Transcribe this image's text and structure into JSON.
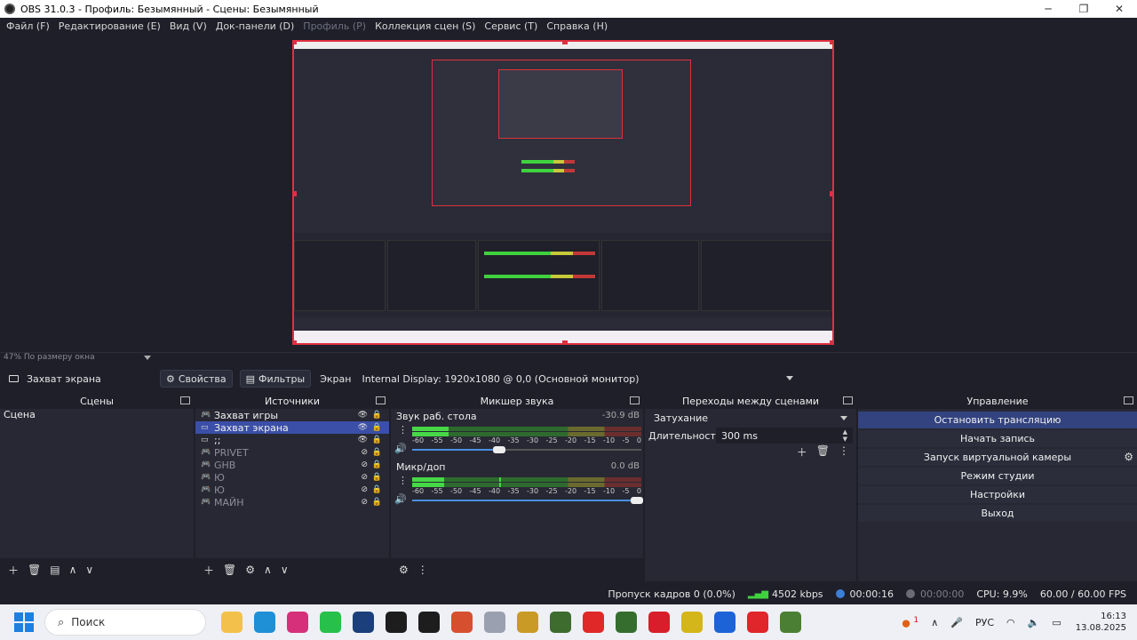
{
  "window": {
    "title": "OBS 31.0.3 - Профиль: Безымянный - Сцены: Безымянный",
    "controls": [
      "─",
      "❐",
      "✕"
    ]
  },
  "menu": [
    {
      "label": "Файл (F)",
      "enabled": true
    },
    {
      "label": "Редактирование (E)",
      "enabled": true
    },
    {
      "label": "Вид (V)",
      "enabled": true
    },
    {
      "label": "Док-панели (D)",
      "enabled": true
    },
    {
      "label": "Профиль (P)",
      "enabled": false
    },
    {
      "label": "Коллекция сцен (S)",
      "enabled": true
    },
    {
      "label": "Сервис (T)",
      "enabled": true
    },
    {
      "label": "Справка (H)",
      "enabled": true
    }
  ],
  "preview": {
    "zoom_label": "47% По размеру окна"
  },
  "source_toolbar": {
    "source_name": "Захват экрана",
    "properties": "Свойства",
    "filters": "Фильтры",
    "display_label": "Экран",
    "display_value": "Internal Display: 1920x1080 @ 0,0 (Основной монитор)"
  },
  "scenes": {
    "title": "Сцены",
    "items": [
      "Сцена"
    ]
  },
  "sources": {
    "title": "Источники",
    "items": [
      {
        "name": "Захват игры",
        "icon": "gamepad-icon",
        "visible": true,
        "selected": false
      },
      {
        "name": "Захват экрана",
        "icon": "monitor-icon",
        "visible": true,
        "selected": true
      },
      {
        "name": ";;",
        "icon": "monitor-icon",
        "visible": true,
        "selected": false
      },
      {
        "name": "PRIVET",
        "icon": "gamepad-icon",
        "visible": false,
        "selected": false
      },
      {
        "name": "GHB",
        "icon": "gamepad-icon",
        "visible": false,
        "selected": false
      },
      {
        "name": "Ю",
        "icon": "gamepad-icon",
        "visible": false,
        "selected": false
      },
      {
        "name": "Ю",
        "icon": "gamepad-icon",
        "visible": false,
        "selected": false
      },
      {
        "name": "МАЙН",
        "icon": "gamepad-icon",
        "visible": false,
        "selected": false
      }
    ]
  },
  "mixer": {
    "title": "Микшер звука",
    "ticks": [
      "-60",
      "-55",
      "-50",
      "-45",
      "-40",
      "-35",
      "-30",
      "-25",
      "-20",
      "-15",
      "-10",
      "-5",
      "0"
    ],
    "channels": [
      {
        "name": "Звук раб. стола",
        "db": "-30.9 dB",
        "level_pct": 16,
        "peak_pct": 15,
        "volume_pct": 40
      },
      {
        "name": "Микр/доп",
        "db": "0.0 dB",
        "level_pct": 14,
        "peak_pct": 38,
        "volume_pct": 100
      }
    ]
  },
  "transitions": {
    "title": "Переходы между сценами",
    "selected": "Затухание",
    "duration_label": "Длительность",
    "duration_value": "300 ms"
  },
  "controls": {
    "title": "Управление",
    "buttons": [
      {
        "label": "Остановить трансляцию",
        "active": true
      },
      {
        "label": "Начать запись",
        "active": false
      },
      {
        "label": "Запуск виртуальной камеры",
        "active": false
      },
      {
        "label": "Режим студии",
        "active": false
      },
      {
        "label": "Настройки",
        "active": false
      },
      {
        "label": "Выход",
        "active": false
      }
    ]
  },
  "status": {
    "dropped": "Пропуск кадров 0 (0.0%)",
    "bitrate": "4502 kbps",
    "stream_time": "00:00:16",
    "rec_time": "00:00:00",
    "cpu": "CPU: 9.9%",
    "fps": "60.00 / 60.00 FPS"
  },
  "taskbar": {
    "search_placeholder": "Поиск",
    "icons": [
      {
        "name": "file-explorer-icon",
        "color": "#f3c14b"
      },
      {
        "name": "edge-icon",
        "color": "#1f8fd6"
      },
      {
        "name": "instagram-icon",
        "color": "#d6307a"
      },
      {
        "name": "whatsapp-icon",
        "color": "#27c04a"
      },
      {
        "name": "terminal-icon",
        "color": "#1a3f7a"
      },
      {
        "name": "obs-icon",
        "color": "#1d1d1d"
      },
      {
        "name": "obs-red-icon",
        "color": "#1d1d1d"
      },
      {
        "name": "launcher-icon",
        "color": "#d65030"
      },
      {
        "name": "app-icon",
        "color": "#9aa0b0"
      },
      {
        "name": "game-icon",
        "color": "#c99a25"
      },
      {
        "name": "minecraft-icon",
        "color": "#3e6b2e"
      },
      {
        "name": "yandex-icon",
        "color": "#e02828"
      },
      {
        "name": "minecraft2-icon",
        "color": "#356d2e"
      },
      {
        "name": "app-red-icon",
        "color": "#d81e2a"
      },
      {
        "name": "app-yellow-icon",
        "color": "#d4b51a"
      },
      {
        "name": "xo-icon",
        "color": "#1d63d8"
      },
      {
        "name": "opera-icon",
        "color": "#e0252b"
      },
      {
        "name": "minecraft3-icon",
        "color": "#4b7f33"
      }
    ],
    "language": "РУС",
    "time": "16:13",
    "date": "13.08.2025",
    "notification_badge": "1"
  }
}
